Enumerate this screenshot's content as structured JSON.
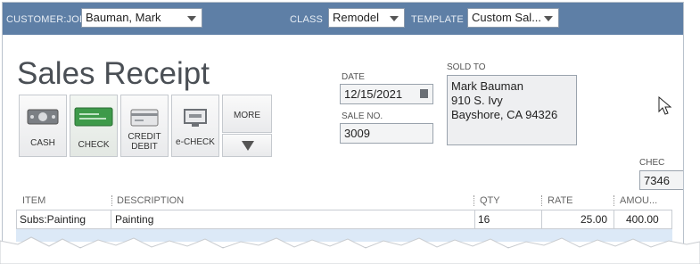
{
  "header": {
    "customer_job_label": "CUSTOMER:JOB",
    "customer_job_value": "Bauman, Mark",
    "class_label": "CLASS",
    "class_value": "Remodel",
    "template_label": "TEMPLATE",
    "template_value": "Custom Sal..."
  },
  "form": {
    "title": "Sales Receipt",
    "date_label": "DATE",
    "date_value": "12/15/2021",
    "sale_no_label": "SALE NO.",
    "sale_no_value": "3009",
    "sold_to_label": "SOLD TO",
    "sold_to_lines": [
      "Mark Bauman",
      "910 S. Ivy",
      "Bayshore, CA  94326"
    ],
    "check_label": "CHEC",
    "check_value": "7346"
  },
  "payment_methods": {
    "cash": "CASH",
    "check": "CHECK",
    "credit_debit_line1": "CREDIT",
    "credit_debit_line2": "DEBIT",
    "echeck": "e-CHECK",
    "more": "MORE"
  },
  "table": {
    "columns": [
      "ITEM",
      "DESCRIPTION",
      "QTY",
      "RATE",
      "AMOU..."
    ],
    "rows": [
      {
        "item": "Subs:Painting",
        "description": "Painting",
        "qty": "16",
        "rate": "25.00",
        "amount": "400.00"
      }
    ]
  },
  "colors": {
    "header_bar": "#5e7fa6",
    "check_icon": "#3e9a4a",
    "row_highlight": "#dce9f7"
  }
}
